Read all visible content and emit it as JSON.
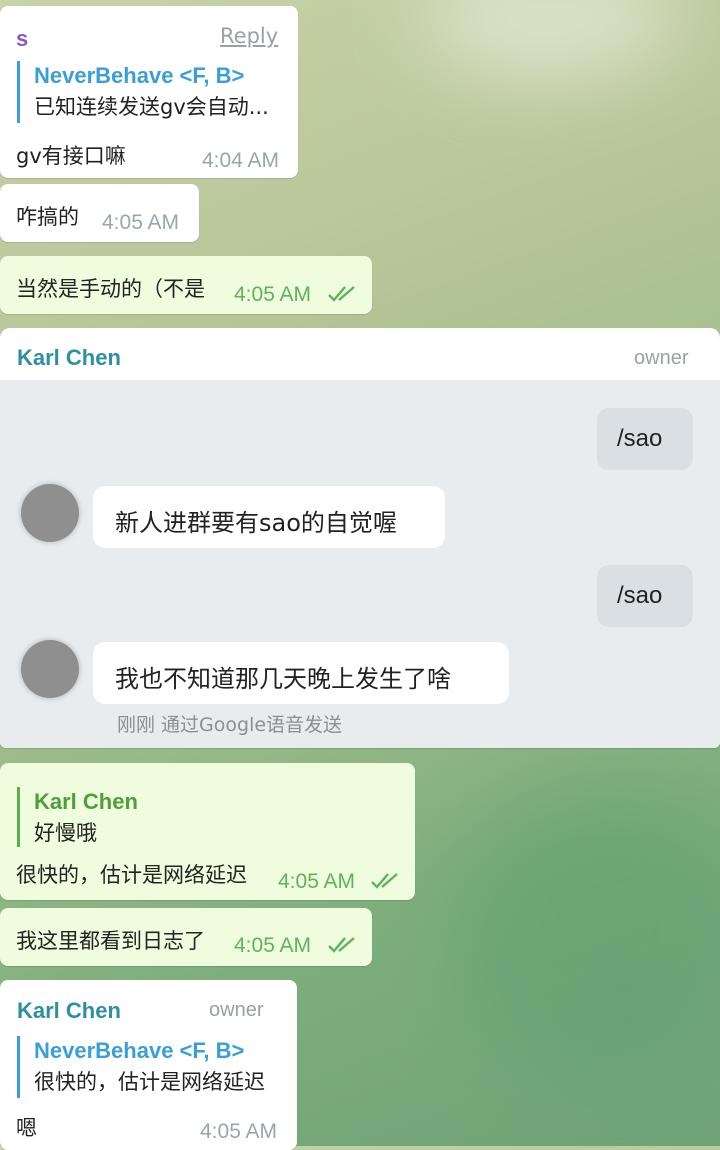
{
  "messages": {
    "m1": {
      "sender": "s",
      "reply_label": "Reply",
      "quote_name": "NeverBehave <F, B>",
      "quote_text": "已知连续发送gv会自动...",
      "text": "gv有接口嘛",
      "time": "4:04 AM"
    },
    "m2": {
      "text": "咋搞的",
      "time": "4:05 AM"
    },
    "m3": {
      "text": "当然是手动的（不是",
      "time": "4:05 AM"
    },
    "m4": {
      "sender": "Karl Chen",
      "role": "owner"
    },
    "m5": {
      "quote_name": "Karl Chen",
      "quote_text": "好慢哦",
      "text": "很快的，估计是网络延迟",
      "time": "4:05 AM"
    },
    "m6": {
      "text": "我这里都看到日志了",
      "time": "4:05 AM"
    },
    "m7": {
      "sender": "Karl Chen",
      "role": "owner",
      "quote_name": "NeverBehave <F, B>",
      "quote_text": "很快的，估计是网络延迟",
      "text": "嗯",
      "time": "4:05 AM"
    }
  },
  "screenshot": {
    "cmd1": "/sao",
    "reply1": "新人进群要有sao的自觉喔",
    "cmd2": "/sao",
    "reply2": "我也不知道那几天晚上发生了啥",
    "caption": "刚刚 通过Google语音发送"
  },
  "colors": {
    "incoming": "#ffffff",
    "outgoing": "#effdde",
    "link_blue": "#3a9fd9",
    "green": "#5eb35a",
    "sender_teal": "#2d8fa0",
    "sender_purple": "#8e57c5"
  }
}
